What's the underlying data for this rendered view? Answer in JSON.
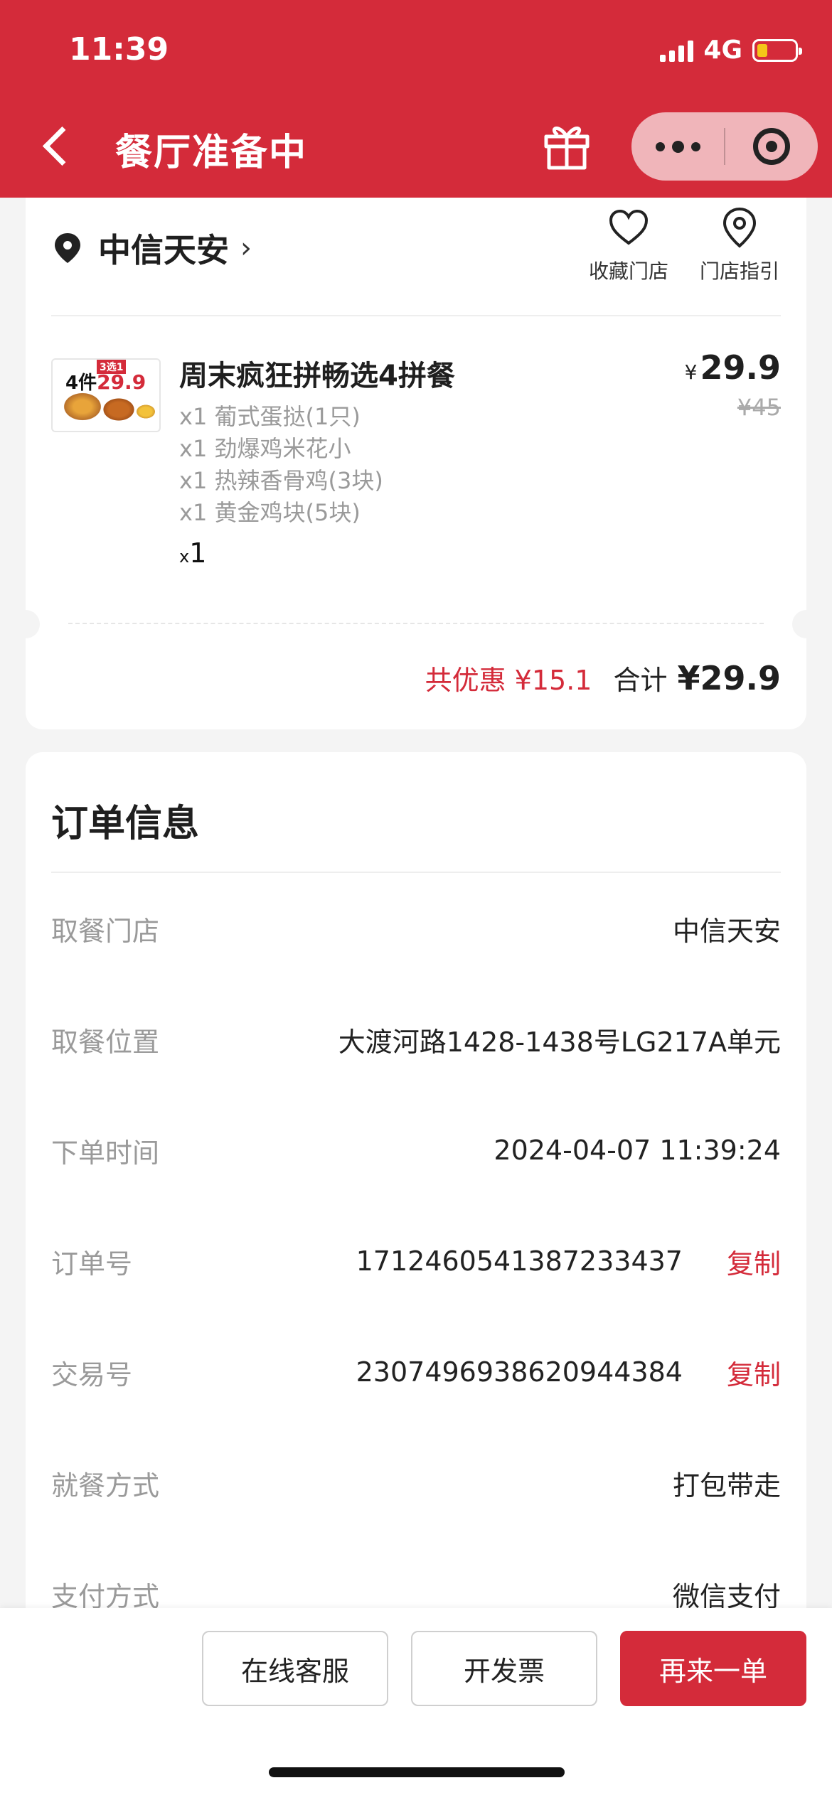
{
  "status_bar": {
    "time": "11:39",
    "network": "4G"
  },
  "header": {
    "title": "餐厅准备中"
  },
  "store": {
    "name": "中信天安",
    "chevron": "›",
    "favorite_label": "收藏门店",
    "guide_label": "门店指引"
  },
  "product": {
    "image_text": "4件",
    "image_price": "29.9",
    "image_badge": "3选1",
    "name": "周末疯狂拼畅选4拼餐",
    "price_symbol": "¥",
    "price": "29.9",
    "original_price": "¥45",
    "items": [
      "x1 葡式蛋挞(1只)",
      "x1 劲爆鸡米花小",
      "x1 热辣香骨鸡(3块)",
      "x1 黄金鸡块(5块)"
    ],
    "qty_prefix": "x",
    "qty": "1"
  },
  "totals": {
    "discount": "共优惠 ¥15.1",
    "total_label": "合计",
    "total_value": "¥29.9"
  },
  "order_info": {
    "title": "订单信息",
    "rows": [
      {
        "label": "取餐门店",
        "value": "中信天安"
      },
      {
        "label": "取餐位置",
        "value": "大渡河路1428-1438号LG217A单元"
      },
      {
        "label": "下单时间",
        "value": "2024-04-07 11:39:24"
      },
      {
        "label": "订单号",
        "value": "1712460541387233437",
        "action": "复制"
      },
      {
        "label": "交易号",
        "value": "2307496938620944384",
        "action": "复制"
      },
      {
        "label": "就餐方式",
        "value": "打包带走"
      },
      {
        "label": "支付方式",
        "value": "微信支付"
      }
    ]
  },
  "bottom_bar": {
    "service_label": "在线客服",
    "invoice_label": "开发票",
    "reorder_label": "再来一单"
  },
  "colors": {
    "brand_red": "#d42b3a",
    "background": "#f4f4f4"
  }
}
